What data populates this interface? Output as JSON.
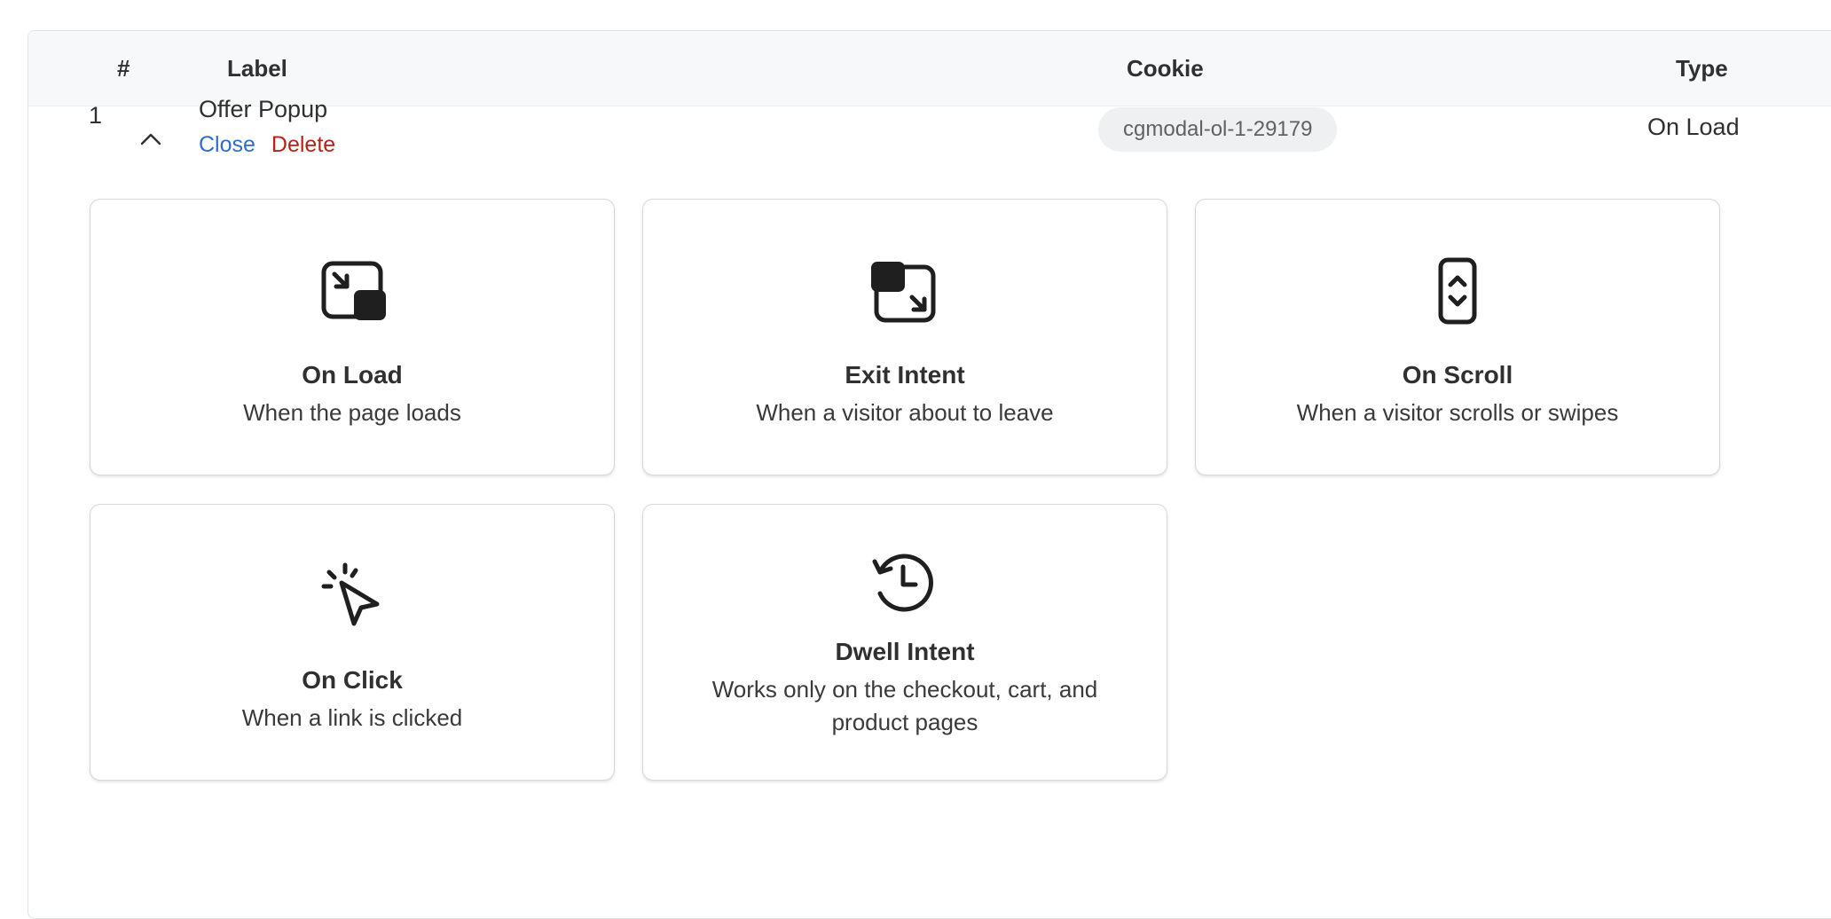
{
  "table": {
    "headers": {
      "num": "#",
      "label": "Label",
      "cookie": "Cookie",
      "type": "Type"
    },
    "row": {
      "num": "1",
      "label": "Offer Popup",
      "close_label": "Close",
      "delete_label": "Delete",
      "cookie": "cgmodal-ol-1-29179",
      "type": "On Load",
      "expanded": true
    }
  },
  "triggers": [
    {
      "icon": "on-load-icon",
      "title": "On Load",
      "desc": "When the page loads"
    },
    {
      "icon": "exit-intent-icon",
      "title": "Exit Intent",
      "desc": "When a visitor about to leave"
    },
    {
      "icon": "on-scroll-icon",
      "title": "On Scroll",
      "desc": "When a visitor scrolls or swipes"
    },
    {
      "icon": "on-click-icon",
      "title": "On Click",
      "desc": "When a link is clicked"
    },
    {
      "icon": "dwell-intent-icon",
      "title": "Dwell Intent",
      "desc": "Works only on the checkout, cart, and product pages"
    }
  ],
  "colors": {
    "link": "#2c6ecb",
    "danger": "#b42318",
    "header_bg": "#f7f8fa",
    "pill_bg": "#eef0f2"
  }
}
